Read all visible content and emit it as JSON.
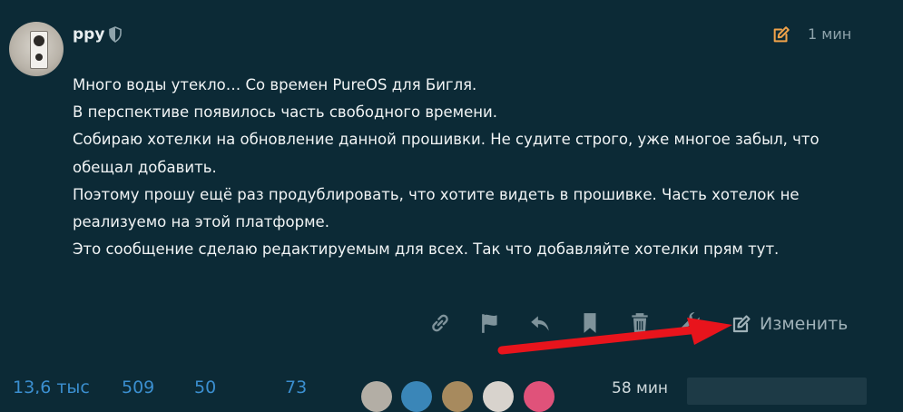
{
  "post": {
    "username": "ppy",
    "time": "1 мин",
    "paragraphs": [
      "Много воды утекло… Со времен PureOS для Бигля.",
      "В перспективе появилось часть свободного времени.",
      "Собираю хотелки на обновление данной прошивки. Не судите строго, уже многое забыл, что обещал добавить.",
      "Поэтому прошу ещё раз продублировать, что хотите видеть в прошивке. Часть хотелок не реализуемо на этой платформе.",
      "Это сообщение сделаю редактируемым для всех. Так что добавляйте хотелки прям тут."
    ]
  },
  "actions": {
    "icons": [
      "link-icon",
      "flag-icon",
      "reply-icon",
      "bookmark-icon",
      "trash-icon",
      "wrench-icon"
    ],
    "edit_label": "Изменить"
  },
  "stats": {
    "views": "13,6 тыс",
    "likes": "509",
    "users": "50",
    "links": "73",
    "last_activity": "58 мин"
  },
  "colors": {
    "background": "#0c2a36",
    "accent_orange": "#f0a24a",
    "link_blue": "#3b8fd0",
    "annotation_arrow": "#e8141c"
  }
}
